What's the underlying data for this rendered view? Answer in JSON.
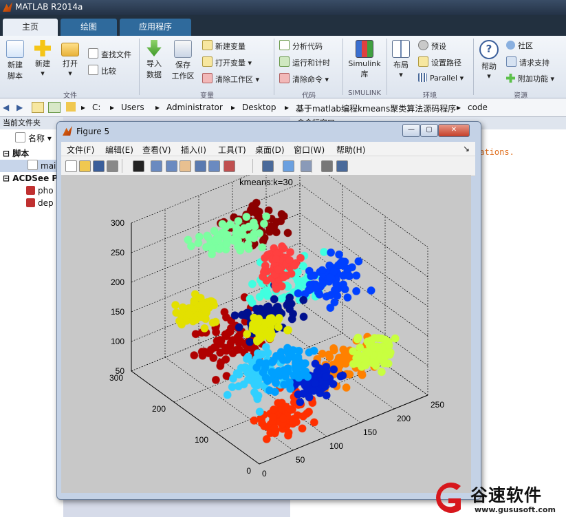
{
  "window": {
    "title": "MATLAB R2014a"
  },
  "tabs": [
    {
      "label": "主页"
    },
    {
      "label": "绘图"
    },
    {
      "label": "应用程序"
    }
  ],
  "ribbon": {
    "file": {
      "new_script": "新建\n脚本",
      "new": "新建",
      "open": "打开",
      "find_files": "查找文件",
      "compare": "比较",
      "section": "文件"
    },
    "variable": {
      "import": "导入\n数据",
      "save": "保存\n工作区",
      "new_var": "新建变量",
      "open_var": "打开变量",
      "clear_ws": "清除工作区",
      "section": "变量"
    },
    "code": {
      "analyze": "分析代码",
      "run_time": "运行和计时",
      "clear_cmd": "清除命令",
      "section": "代码"
    },
    "simulink": {
      "lib": "Simulink\n库",
      "section": "SIMULINK"
    },
    "env": {
      "layout": "布局",
      "prefs": "预设",
      "set_path": "设置路径",
      "parallel": "Parallel",
      "section": "环境"
    },
    "resources": {
      "help": "帮助",
      "community": "社区",
      "support": "请求支持",
      "addons": "附加功能",
      "section": "资源"
    }
  },
  "address": {
    "path": [
      "C:",
      "Users",
      "Administrator",
      "Desktop",
      "基于matlab编程kmeans聚类算法源码程序",
      "code"
    ]
  },
  "left_panel": {
    "title": "当前文件夹",
    "col_name": "名称",
    "groups": [
      {
        "label": "脚本",
        "items": [
          "main"
        ]
      },
      {
        "label": "ACDSee P",
        "items": [
          "pho",
          "dep"
        ]
      }
    ]
  },
  "right_panel": {
    "title": "命令行窗口",
    "text": "rations."
  },
  "figure": {
    "title": "Figure 5",
    "menu": [
      "文件(F)",
      "编辑(E)",
      "查看(V)",
      "插入(I)",
      "工具(T)",
      "桌面(D)",
      "窗口(W)",
      "帮助(H)"
    ],
    "toolbar_icons": [
      "new-figure-icon",
      "open-icon",
      "save-icon",
      "print-icon",
      "pointer-icon",
      "zoom-in-icon",
      "zoom-out-icon",
      "pan-icon",
      "rotate-icon",
      "datacursor-icon",
      "brush-icon",
      "link-icon",
      "colorbar-icon",
      "legend-icon",
      "hide-tools-icon",
      "show-tools-icon"
    ]
  },
  "chart_data": {
    "type": "scatter",
    "title": "kmeans:k=30",
    "xlabel": "",
    "ylabel": "",
    "zlabel": "",
    "grid": true,
    "xlim": [
      0,
      250
    ],
    "ylim": [
      0,
      300
    ],
    "zlim": [
      50,
      300
    ],
    "x_ticks": [
      "0",
      "50",
      "100",
      "150",
      "200",
      "250"
    ],
    "y_ticks": [
      "0",
      "100",
      "200",
      "300"
    ],
    "z_ticks": [
      "50",
      "100",
      "150",
      "200",
      "250",
      "300"
    ],
    "series": [
      {
        "color": "#8b0000",
        "x": 130,
        "y": 220,
        "z": 280,
        "spread": [
          18,
          18,
          6
        ]
      },
      {
        "color": "#b00000",
        "x": 60,
        "y": 160,
        "z": 150,
        "spread": [
          20,
          20,
          20
        ]
      },
      {
        "color": "#e3e000",
        "x": 20,
        "y": 180,
        "z": 205,
        "spread": [
          15,
          12,
          8
        ]
      },
      {
        "color": "#7cffa0",
        "x": 110,
        "y": 240,
        "z": 255,
        "spread": [
          22,
          14,
          8
        ]
      },
      {
        "color": "#40ffe0",
        "x": 150,
        "y": 170,
        "z": 200,
        "spread": [
          24,
          18,
          14
        ]
      },
      {
        "color": "#0040ff",
        "x": 200,
        "y": 140,
        "z": 200,
        "spread": [
          20,
          16,
          14
        ]
      },
      {
        "color": "#00108f",
        "x": 120,
        "y": 170,
        "z": 155,
        "spread": [
          20,
          14,
          8
        ]
      },
      {
        "color": "#ff8000",
        "x": 170,
        "y": 70,
        "z": 105,
        "spread": [
          22,
          16,
          14
        ]
      },
      {
        "color": "#ff3000",
        "x": 60,
        "y": 40,
        "z": 80,
        "spread": [
          18,
          12,
          16
        ]
      },
      {
        "color": "#30d0ff",
        "x": 70,
        "y": 110,
        "z": 110,
        "spread": [
          22,
          18,
          16
        ]
      },
      {
        "color": "#0020d0",
        "x": 140,
        "y": 90,
        "z": 80,
        "spread": [
          14,
          12,
          8
        ]
      },
      {
        "color": "#c8ff40",
        "x": 220,
        "y": 80,
        "z": 95,
        "spread": [
          14,
          12,
          10
        ]
      },
      {
        "color": "#ff4040",
        "x": 150,
        "y": 190,
        "z": 215,
        "spread": [
          10,
          10,
          14
        ]
      },
      {
        "color": "#e0e800",
        "x": 100,
        "y": 150,
        "z": 155,
        "spread": [
          10,
          10,
          8
        ]
      },
      {
        "color": "#00a0ff",
        "x": 90,
        "y": 80,
        "z": 130,
        "spread": [
          18,
          14,
          12
        ]
      }
    ]
  },
  "watermark": {
    "name": "谷速软件",
    "url": "www.gususoft.com"
  },
  "colors": {
    "accent": "#2f6a9c",
    "titlebar": "#2a3a52"
  }
}
